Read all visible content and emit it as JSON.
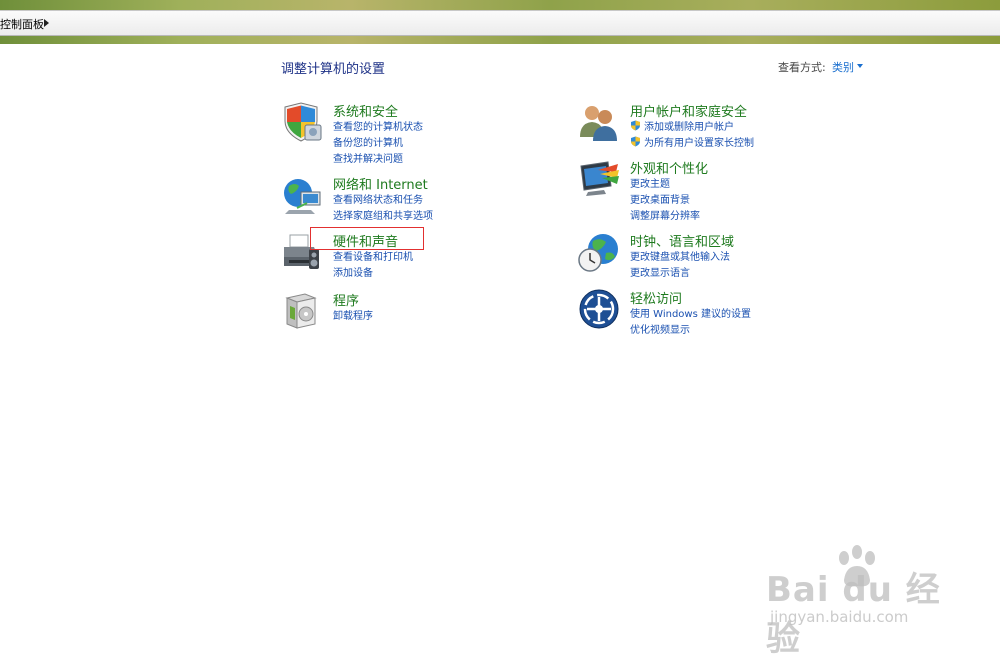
{
  "address_bar": {
    "crumb": "控制面板"
  },
  "header": {
    "title": "调整计算机的设置",
    "view_by_label": "查看方式:",
    "view_by_value": "类别"
  },
  "categories": {
    "system": {
      "title": "系统和安全",
      "links": [
        "查看您的计算机状态",
        "备份您的计算机",
        "查找并解决问题"
      ]
    },
    "network": {
      "title": "网络和 Internet",
      "links": [
        "查看网络状态和任务",
        "选择家庭组和共享选项"
      ]
    },
    "hardware": {
      "title": "硬件和声音",
      "links": [
        "查看设备和打印机",
        "添加设备"
      ]
    },
    "programs": {
      "title": "程序",
      "links": [
        "卸载程序"
      ]
    },
    "users": {
      "title": "用户帐户和家庭安全",
      "links": [
        "添加或删除用户帐户",
        "为所有用户设置家长控制"
      ]
    },
    "appearance": {
      "title": "外观和个性化",
      "links": [
        "更改主题",
        "更改桌面背景",
        "调整屏幕分辨率"
      ]
    },
    "clock": {
      "title": "时钟、语言和区域",
      "links": [
        "更改键盘或其他输入法",
        "更改显示语言"
      ]
    },
    "ease": {
      "title": "轻松访问",
      "links": [
        "使用 Windows 建议的设置",
        "优化视频显示"
      ]
    }
  },
  "watermark": {
    "brand": "Bai du 经验",
    "url": "jingyan.baidu.com"
  },
  "colors": {
    "title_blue": "#1e3287",
    "category_green": "#1e7a1e",
    "link_blue": "#1a50b0",
    "highlight_red": "#e23030"
  }
}
